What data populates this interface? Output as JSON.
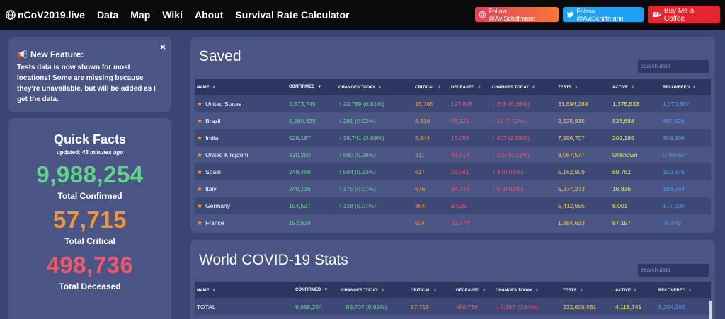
{
  "nav": {
    "brand": "nCoV2019.live",
    "links": [
      "Data",
      "Map",
      "Wiki",
      "About",
      "Survival Rate Calculator"
    ],
    "instagram": "Follow @AviSchiffmann",
    "twitter": "Follow @AviSchiffmann",
    "coffee": "Buy Me a Coffee"
  },
  "feature": {
    "title": "New Feature:",
    "body": "Tests data is now shown for most locations! Some are missing because they're unavailable, but will be added as I get the data.",
    "close": "×"
  },
  "quick": {
    "title": "Quick Facts",
    "updated_prefix": "updated:",
    "updated_time": "43 minutes ago",
    "confirmed": "9,988,254",
    "confirmed_label": "Total Confirmed",
    "critical": "57,715",
    "critical_label": "Total Critical",
    "deceased": "498,736",
    "deceased_label": "Total Deceased"
  },
  "saved": {
    "title": "Saved",
    "search_placeholder": "search data",
    "columns": [
      "NAME",
      "CONFIRMED",
      "CHANGES TODAY",
      "CRITICAL",
      "DECEASED",
      "CHANGES TODAY",
      "TESTS",
      "ACTIVE",
      "RECOVERED"
    ],
    "rows": [
      {
        "name": "United States",
        "confirmed": "2,573,745",
        "change": "↑ 20,789 (0.81%)",
        "critical": "15,765",
        "deceased": "127,845",
        "dchange": "↑ 205 (0.16%)",
        "tests": "31,594,288",
        "active": "1,375,533",
        "recovered": "1,070,367"
      },
      {
        "name": "Brazil",
        "confirmed": "1,280,335",
        "change": "↑ 281 (0.02%)",
        "critical": "8,318",
        "deceased": "56,121",
        "dchange": "↑ 12 (0.02%)",
        "tests": "2,925,935",
        "active": "526,688",
        "recovered": "697,526"
      },
      {
        "name": "India",
        "confirmed": "528,187",
        "change": "↑ 18,741 (3.68%)",
        "critical": "8,944",
        "deceased": "16,096",
        "dchange": "↑ 407 (2.59%)",
        "tests": "7,996,707",
        "active": "202,185",
        "recovered": "309,906"
      },
      {
        "name": "United Kingdom",
        "confirmed": "310,250",
        "change": "↑ 890 (0.29%)",
        "critical": "311",
        "deceased": "43,514",
        "dchange": "↑ 100 (0.23%)",
        "tests": "9,067,577",
        "active": "Unknown",
        "recovered": "Unknown"
      },
      {
        "name": "Spain",
        "confirmed": "248,469",
        "change": "↑ 564 (0.23%)",
        "critical": "617",
        "deceased": "28,341",
        "dchange": "↑ 3 (0.01%)",
        "tests": "5,162,909",
        "active": "69,752",
        "recovered": "150,376"
      },
      {
        "name": "Italy",
        "confirmed": "240,136",
        "change": "↑ 175 (0.07%)",
        "critical": "676",
        "deceased": "34,716",
        "dchange": "↑ 8 (0.02%)",
        "tests": "5,277,273",
        "active": "16,836",
        "recovered": "188,584"
      },
      {
        "name": "Germany",
        "confirmed": "194,527",
        "change": "↑ 128 (0.07%)",
        "critical": "364",
        "deceased": "9,026",
        "dchange": "",
        "tests": "5,412,655",
        "active": "8,001",
        "recovered": "177,500"
      },
      {
        "name": "France",
        "confirmed": "192,624",
        "change": "",
        "critical": "634",
        "deceased": "29,778",
        "dchange": "",
        "tests": "1,384,633",
        "active": "87,197",
        "recovered": "75,649"
      }
    ]
  },
  "world": {
    "title": "World COVID-19 Stats",
    "search_placeholder": "search data",
    "columns": [
      "NAME",
      "CONFIRMED",
      "CHANGES TODAY",
      "CRITICAL",
      "DECEASED",
      "CHANGES TODAY",
      "TESTS",
      "ACTIVE",
      "RECOVERED"
    ],
    "rows": [
      {
        "name": "TOTAL",
        "confirmed": "9,988,254",
        "change": "↑ 89,707 (0.91%)",
        "critical": "57,715",
        "deceased": "498,736",
        "dchange": "↑ 2,657 (0.54%)",
        "tests": "232,608,081",
        "active": "4,118,741",
        "recovered": "5,204,385"
      }
    ]
  }
}
